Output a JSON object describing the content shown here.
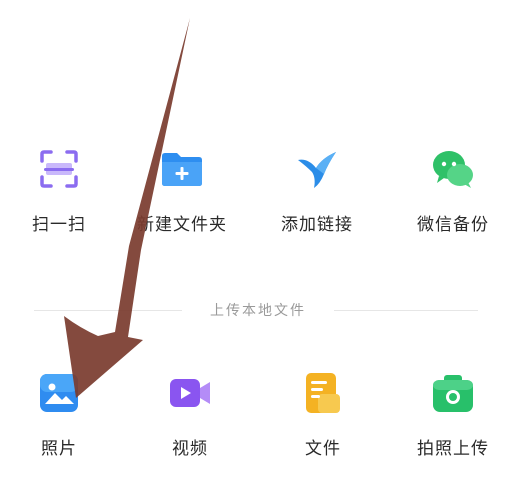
{
  "actions": {
    "scan_label": "扫一扫",
    "new_folder_label": "新建文件夹",
    "add_link_label": "添加链接",
    "wechat_backup_label": "微信备份"
  },
  "upload_section": {
    "title": "上传本地文件",
    "photos_label": "照片",
    "video_label": "视频",
    "file_label": "文件",
    "photo_upload_label": "拍照上传"
  },
  "icons": {
    "scan": "scan-frame-icon",
    "new_folder": "folder-plus-icon",
    "add_link": "bird-link-icon",
    "wechat_backup": "wechat-icon",
    "photos": "image-icon",
    "video": "video-camera-icon",
    "file": "document-icon",
    "photo_upload": "camera-icon"
  },
  "colors": {
    "scan": "#8b6cf0",
    "folder": "#2e8ef0",
    "link": "#2b8de8",
    "wechat": "#2fc168",
    "photos": "#2f8cf0",
    "video": "#8a55f0",
    "file": "#f4b223",
    "camera": "#28c06a",
    "arrow": "#7a3b2e"
  }
}
